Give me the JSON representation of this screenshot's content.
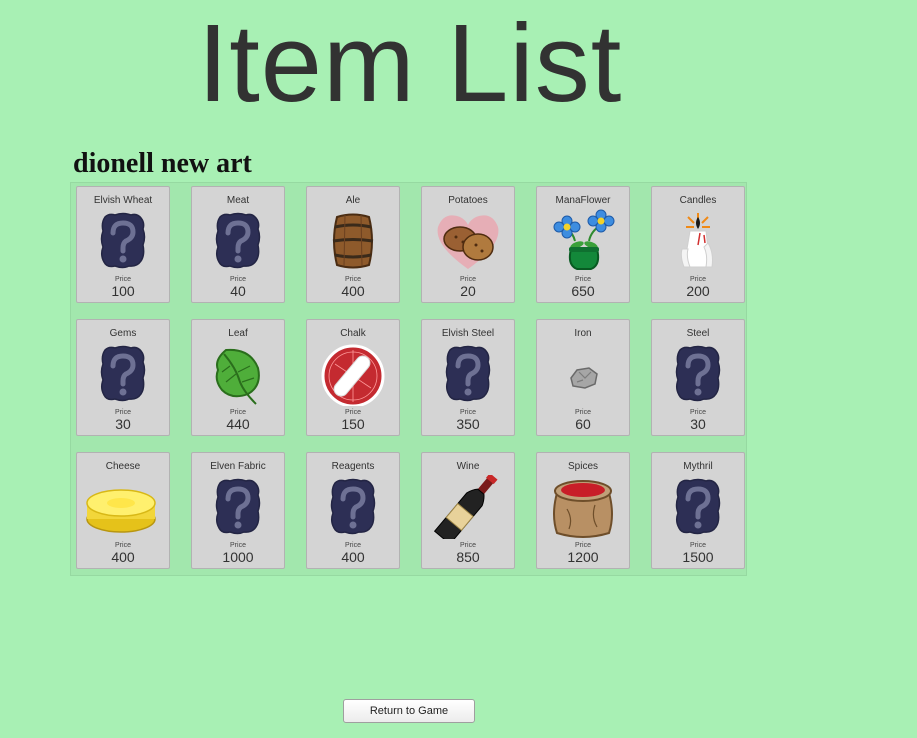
{
  "title": "Item List",
  "subtitle": "dionell new art",
  "price_label": "Price",
  "return_button": "Return to Game",
  "items": [
    {
      "name": "Elvish Wheat",
      "price": "100",
      "icon": "question-icon"
    },
    {
      "name": "Meat",
      "price": "40",
      "icon": "question-icon"
    },
    {
      "name": "Ale",
      "price": "400",
      "icon": "barrel-icon"
    },
    {
      "name": "Potatoes",
      "price": "20",
      "icon": "potatoes-icon"
    },
    {
      "name": "ManaFlower",
      "price": "650",
      "icon": "flower-pot-icon"
    },
    {
      "name": "Candles",
      "price": "200",
      "icon": "candles-icon"
    },
    {
      "name": "Gems",
      "price": "30",
      "icon": "question-icon"
    },
    {
      "name": "Leaf",
      "price": "440",
      "icon": "leaf-icon"
    },
    {
      "name": "Chalk",
      "price": "150",
      "icon": "chalk-icon"
    },
    {
      "name": "Elvish Steel",
      "price": "350",
      "icon": "question-icon"
    },
    {
      "name": "Iron",
      "price": "60",
      "icon": "iron-ore-icon"
    },
    {
      "name": "Steel",
      "price": "30",
      "icon": "question-icon"
    },
    {
      "name": "Cheese",
      "price": "400",
      "icon": "cheese-icon"
    },
    {
      "name": "Elven Fabric",
      "price": "1000",
      "icon": "question-icon"
    },
    {
      "name": "Reagents",
      "price": "400",
      "icon": "question-icon"
    },
    {
      "name": "Wine",
      "price": "850",
      "icon": "wine-bottle-icon"
    },
    {
      "name": "Spices",
      "price": "1200",
      "icon": "spice-sack-icon"
    },
    {
      "name": "Mythril",
      "price": "1500",
      "icon": "question-icon"
    }
  ]
}
